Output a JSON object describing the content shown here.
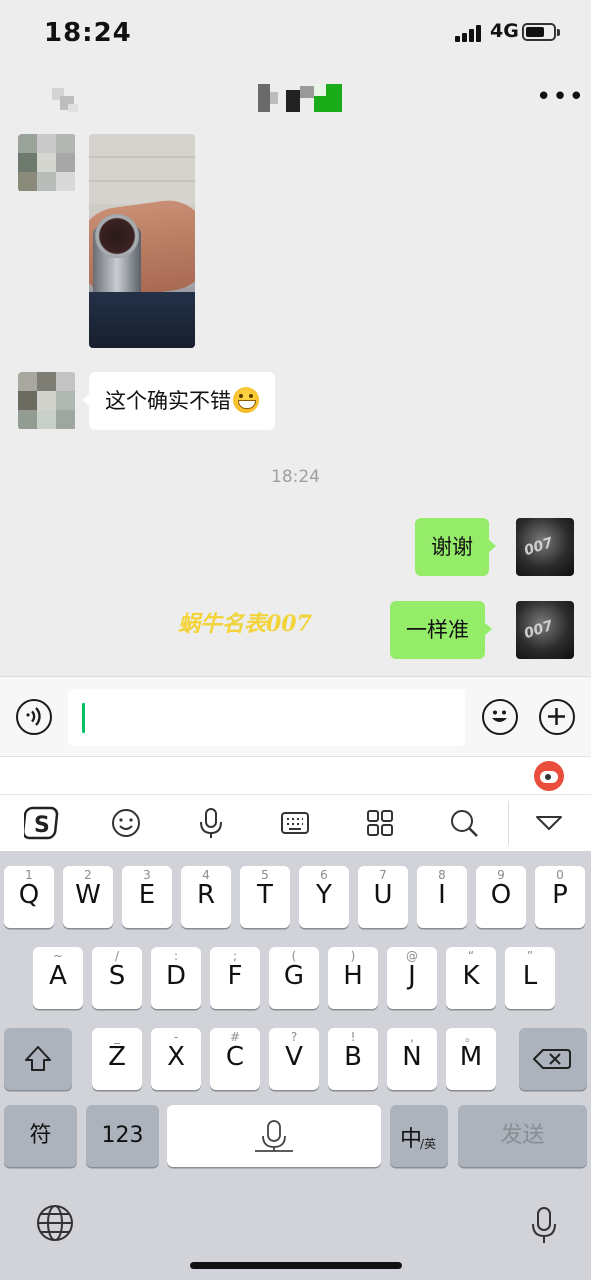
{
  "status_bar": {
    "time": "18:24",
    "network": "4G",
    "battery_level": 0.7
  },
  "nav": {
    "title": "",
    "more_icon": "ellipsis-icon"
  },
  "messages": [
    {
      "side": "left",
      "type": "image",
      "content": "wristwatch-photo"
    },
    {
      "side": "left",
      "type": "text",
      "text": "这个确实不错",
      "emoji": "grinning-face"
    },
    {
      "type": "timestamp",
      "text": "18:24"
    },
    {
      "side": "right",
      "type": "text",
      "text": "谢谢"
    },
    {
      "side": "right",
      "type": "text",
      "text": "一样准"
    }
  ],
  "my_avatar_text": "007",
  "watermark": "蜗牛名表007",
  "input_bar": {
    "voice_icon": "voice-icon",
    "emoji_icon": "emoji-icon",
    "plus_icon": "plus-icon",
    "value": ""
  },
  "ime_toolbar": [
    "sogou-logo-icon",
    "smiley-icon",
    "mic-icon",
    "keyboard-icon",
    "grid-icon",
    "search-icon",
    "collapse-icon"
  ],
  "keyboard": {
    "row1": [
      {
        "k": "Q",
        "s": "1"
      },
      {
        "k": "W",
        "s": "2"
      },
      {
        "k": "E",
        "s": "3"
      },
      {
        "k": "R",
        "s": "4"
      },
      {
        "k": "T",
        "s": "5"
      },
      {
        "k": "Y",
        "s": "6"
      },
      {
        "k": "U",
        "s": "7"
      },
      {
        "k": "I",
        "s": "8"
      },
      {
        "k": "O",
        "s": "9"
      },
      {
        "k": "P",
        "s": "0"
      }
    ],
    "row2": [
      {
        "k": "A",
        "s": "~"
      },
      {
        "k": "S",
        "s": "/"
      },
      {
        "k": "D",
        "s": ":"
      },
      {
        "k": "F",
        "s": ";"
      },
      {
        "k": "G",
        "s": "("
      },
      {
        "k": "H",
        "s": ")"
      },
      {
        "k": "J",
        "s": "@"
      },
      {
        "k": "K",
        "s": "“"
      },
      {
        "k": "L",
        "s": "”"
      }
    ],
    "row3": [
      {
        "k": "Z",
        "s": "_"
      },
      {
        "k": "X",
        "s": "-"
      },
      {
        "k": "C",
        "s": "#"
      },
      {
        "k": "V",
        "s": "?"
      },
      {
        "k": "B",
        "s": "!"
      },
      {
        "k": "N",
        "s": ","
      },
      {
        "k": "M",
        "s": "。"
      }
    ],
    "symbol_key": "符",
    "num_key": "123",
    "lang_key_main": "中",
    "lang_key_sub": "/英",
    "send_key": "发送"
  },
  "colors": {
    "bubble_green": "#95ec69",
    "caret": "#07c160",
    "background": "#ededed"
  }
}
